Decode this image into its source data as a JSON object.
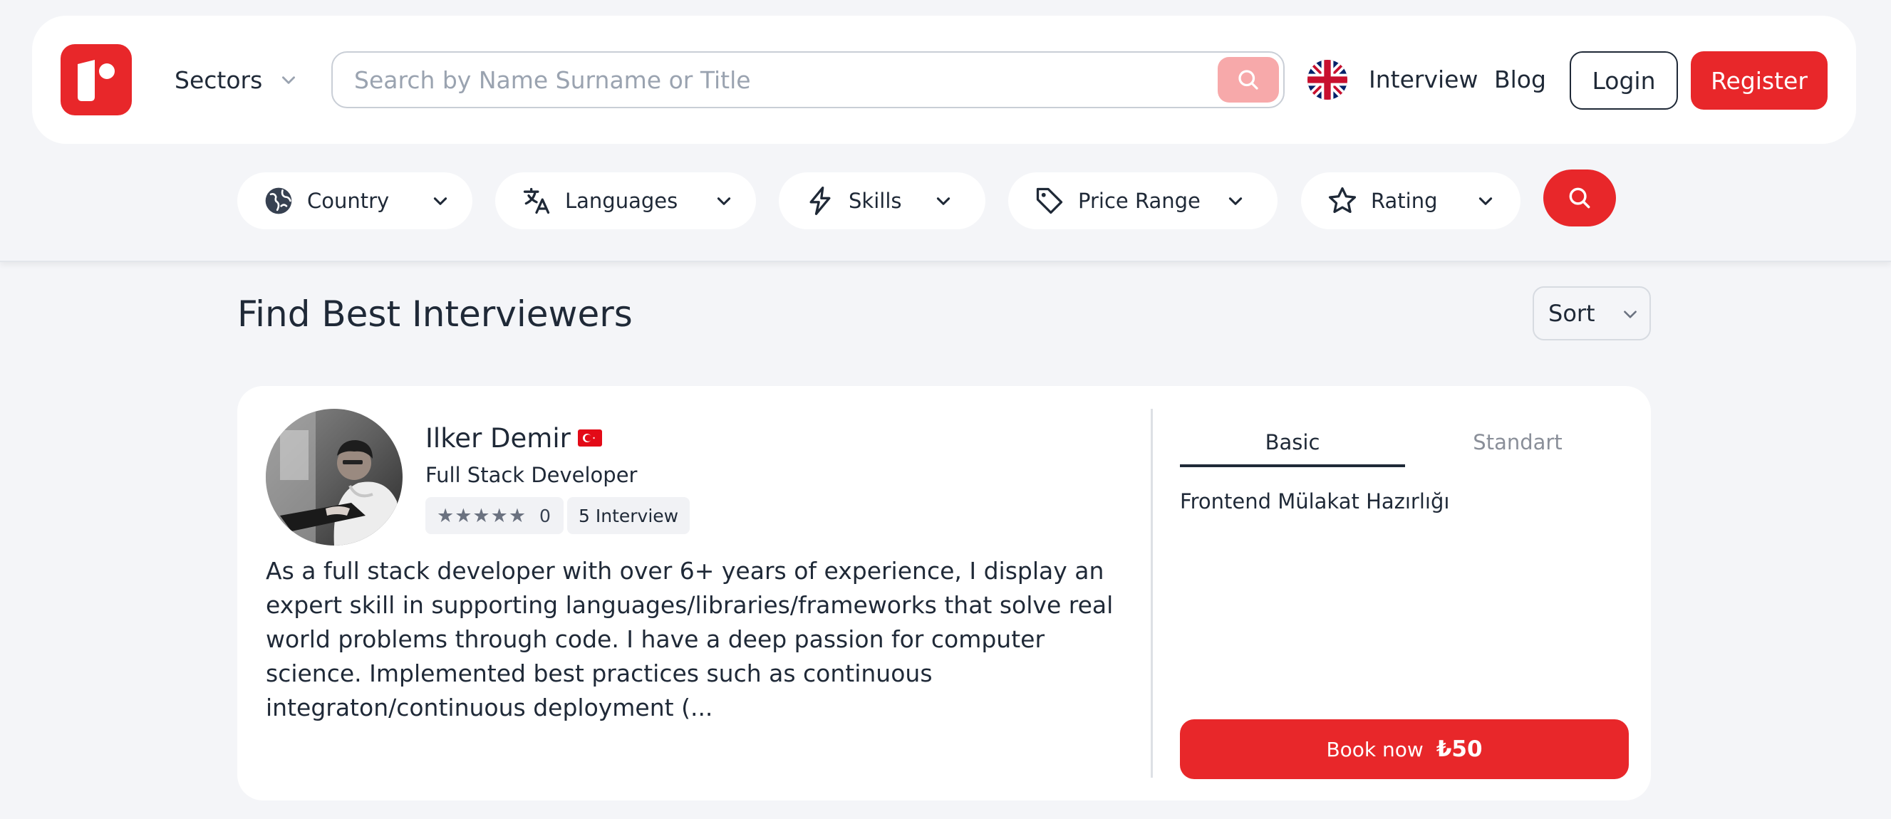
{
  "header": {
    "sectors_label": "Sectors",
    "search_placeholder": "Search by Name Surname or Title",
    "nav_interview": "Interview",
    "nav_blog": "Blog",
    "login_label": "Login",
    "register_label": "Register",
    "language_flag": "uk-flag-icon"
  },
  "filters": {
    "country": "Country",
    "languages": "Languages",
    "skills": "Skills",
    "price_range": "Price Range",
    "rating": "Rating"
  },
  "main": {
    "title": "Find Best Interviewers",
    "sort_label": "Sort"
  },
  "card": {
    "name": "Ilker Demir",
    "role": "Full Stack Developer",
    "stars": "★★★★★",
    "rating_count": "0",
    "interview_count": "5 Interview",
    "bio": "As a full stack developer with over 6+ years of experience, I display an expert skill in supporting languages/libraries/frameworks that solve real world problems through code. I have a deep passion for computer science. Implemented best practices such as continuous integraton/continuous deployment (...",
    "tabs": [
      "Basic",
      "Standart"
    ],
    "active_tab": "Basic",
    "package_title": "Frontend Mülakat Hazırlığı",
    "book_label": "Book now",
    "book_price": "₺50"
  },
  "colors": {
    "brand": "#e8272a",
    "brand_light": "#f7a9aa",
    "text": "#1f2937",
    "background": "#f4f5f8"
  }
}
